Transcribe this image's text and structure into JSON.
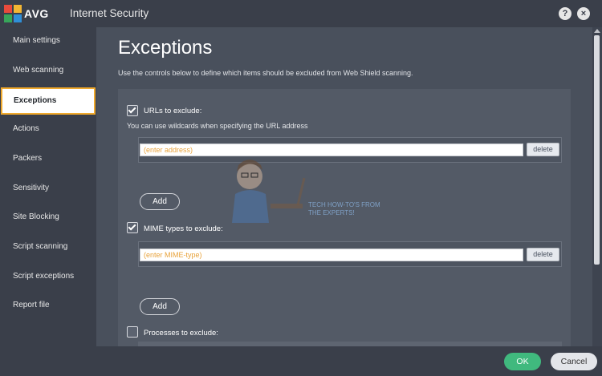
{
  "window": {
    "brand": "AVG",
    "title": "Internet Security",
    "help_label": "?",
    "close_label": "×"
  },
  "sidebar": {
    "items": [
      {
        "label": "Main settings"
      },
      {
        "label": "Web scanning"
      },
      {
        "label": "Exceptions",
        "active": true
      },
      {
        "label": "Actions"
      },
      {
        "label": "Packers"
      },
      {
        "label": "Sensitivity"
      },
      {
        "label": "Site Blocking"
      },
      {
        "label": "Script scanning"
      },
      {
        "label": "Script exceptions"
      },
      {
        "label": "Report file"
      }
    ]
  },
  "main": {
    "title": "Exceptions",
    "description": "Use the controls below to define which items should be excluded from Web Shield scanning.",
    "urls": {
      "label": "URLs to exclude:",
      "checked": true,
      "hint": "You can use wildcards when specifying the URL address",
      "placeholder": "(enter address)",
      "delete_label": "delete",
      "add_label": "Add"
    },
    "mime": {
      "label": "MIME types to exclude:",
      "checked": true,
      "placeholder": "(enter MIME-type)",
      "delete_label": "delete",
      "add_label": "Add"
    },
    "processes": {
      "label": "Processes to exclude:",
      "checked": false
    }
  },
  "watermark": {
    "line1": "TECH HOW-TO'S FROM",
    "line2": "THE EXPERTS!"
  },
  "footer": {
    "ok_label": "OK",
    "cancel_label": "Cancel"
  },
  "colors": {
    "accent_active": "#f0a92c",
    "ok_green": "#40b97e",
    "placeholder_orange": "#e8a23a"
  }
}
